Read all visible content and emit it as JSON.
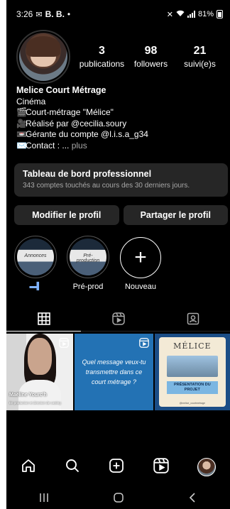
{
  "status_bar": {
    "time": "3:26",
    "carrier_icons": "B. B.",
    "battery": "81%"
  },
  "profile": {
    "stats": [
      {
        "num": "3",
        "label": "publications"
      },
      {
        "num": "98",
        "label": "followers"
      },
      {
        "num": "21",
        "label": "suivi(e)s"
      }
    ]
  },
  "bio": {
    "name": "Melice Court Métrage",
    "category": "Cinéma",
    "lines": [
      {
        "icon": "🎬",
        "text": "Court-métrage \"Mélice\""
      },
      {
        "icon": "🎥",
        "text": "Réalisé par @cecilia.soury"
      },
      {
        "icon": "📼",
        "text": "Gérante du compte @l.i.s.a_g34"
      },
      {
        "icon": "✉️",
        "text": "Contact : ..."
      }
    ],
    "more": "plus"
  },
  "dashboard": {
    "title": "Tableau de bord professionnel",
    "subtitle": "343 comptes touchés au cours des 30 derniers jours."
  },
  "buttons": {
    "edit": "Modifier le profil",
    "share": "Partager le profil"
  },
  "highlights": [
    {
      "label": "",
      "image_text": "Annonces"
    },
    {
      "label": "Pré-prod",
      "image_text": "Pré-production"
    },
    {
      "label": "Nouveau"
    }
  ],
  "posts": {
    "post1": {
      "name": "Maëline Yourc'h",
      "role": "En production et direction de casting"
    },
    "post2": {
      "text": "Quel message veux-tu transmettre dans ce court métrage ?"
    },
    "post3": {
      "logo": "MÉLICE",
      "title": "PRÉSENTATION DU PROJET",
      "footer": "@melice_courtmetrage"
    }
  },
  "nav": {
    "items": [
      "home-icon",
      "search-icon",
      "create-icon",
      "reels-icon",
      "profile-avatar"
    ]
  }
}
